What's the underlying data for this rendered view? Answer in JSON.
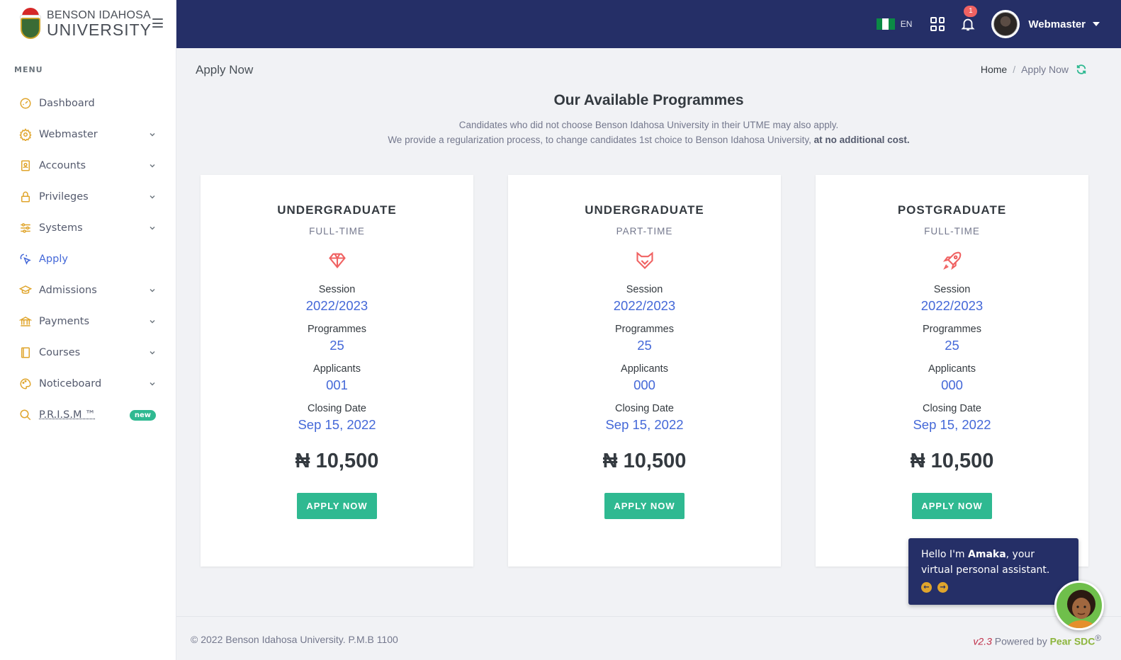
{
  "brand": {
    "line1": "BENSON IDAHOSA",
    "line2": "UNIVERSITY"
  },
  "sidebar": {
    "menu_title": "MENU",
    "items": [
      {
        "label": "Dashboard",
        "icon": "speedometer-icon",
        "has_children": false
      },
      {
        "label": "Webmaster",
        "icon": "settings-icon",
        "has_children": true
      },
      {
        "label": "Accounts",
        "icon": "contact-book-icon",
        "has_children": true
      },
      {
        "label": "Privileges",
        "icon": "lock-icon",
        "has_children": true
      },
      {
        "label": "Systems",
        "icon": "sliders-icon",
        "has_children": true
      },
      {
        "label": "Apply",
        "icon": "pointer-click-icon",
        "has_children": false,
        "active": true
      },
      {
        "label": "Admissions",
        "icon": "graduation-cap-icon",
        "has_children": true
      },
      {
        "label": "Payments",
        "icon": "bank-icon",
        "has_children": true
      },
      {
        "label": "Courses",
        "icon": "book-icon",
        "has_children": true
      },
      {
        "label": "Noticeboard",
        "icon": "palette-icon",
        "has_children": true
      },
      {
        "label": "P.R.I.S.M ™",
        "icon": "search-icon",
        "badge": "new"
      }
    ]
  },
  "topbar": {
    "lang": "EN",
    "notification_count": "1",
    "user_name": "Webmaster",
    "flag_colors": [
      "#0b8a45",
      "#ffffff",
      "#0b8a45"
    ]
  },
  "page": {
    "title": "Apply Now",
    "breadcrumb": {
      "home": "Home",
      "separator": "/",
      "current": "Apply Now"
    }
  },
  "intro": {
    "title": "Our Available Programmes",
    "line1": "Candidates who did not choose Benson Idahosa University in their UTME may also apply.",
    "line2": "We provide a regularization process, to change candidates 1st choice to Benson Idahosa University,",
    "line2_bold": "at no additional cost."
  },
  "labels": {
    "session": "Session",
    "programmes": "Programmes",
    "applicants": "Applicants",
    "closing_date": "Closing Date",
    "apply_button": "APPLY NOW"
  },
  "cards": [
    {
      "title": "UNDERGRADUATE",
      "subtitle": "FULL-TIME",
      "icon": "diamond-icon",
      "session": "2022/2023",
      "programmes": "25",
      "applicants": "001",
      "closing_date": "Sep 15, 2022",
      "price": "₦ 10,500"
    },
    {
      "title": "UNDERGRADUATE",
      "subtitle": "PART-TIME",
      "icon": "fox-icon",
      "session": "2022/2023",
      "programmes": "25",
      "applicants": "000",
      "closing_date": "Sep 15, 2022",
      "price": "₦ 10,500"
    },
    {
      "title": "POSTGRADUATE",
      "subtitle": "FULL-TIME",
      "icon": "rocket-icon",
      "session": "2022/2023",
      "programmes": "25",
      "applicants": "000",
      "closing_date": "Sep 15, 2022",
      "price": "₦ 10,500"
    }
  ],
  "footer": {
    "copyright": "© 2022 Benson Idahosa University. P.M.B 1100",
    "version": "v2.3",
    "powered_by": "Powered by",
    "vendor": "Pear SDC",
    "vendor_mark": "®"
  },
  "assistant": {
    "greeting_pre": "Hello I'm",
    "name": "Amaka",
    "greeting_post": ", your virtual personal assistant."
  },
  "colors": {
    "topbar": "#252f67",
    "accent_blue": "#4468d8",
    "accent_green": "#2fb991",
    "icon_red": "#f06262",
    "icon_gold": "#e0a52c"
  }
}
